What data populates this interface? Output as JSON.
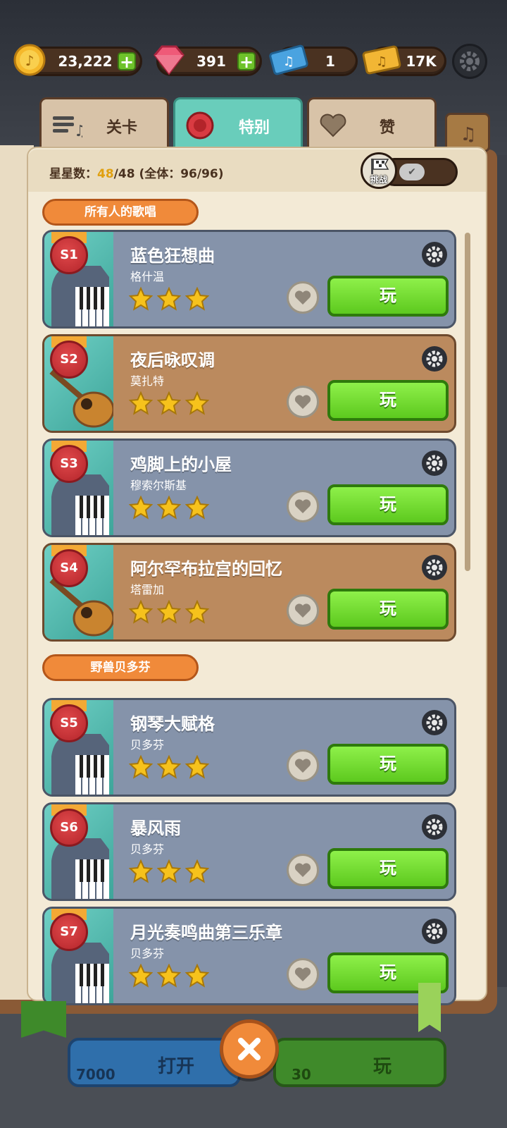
{
  "currency": {
    "coins": "23,222",
    "gems": "391",
    "tickets_blue": "1",
    "tickets_gold": "17K"
  },
  "tabs": [
    {
      "label": "关卡",
      "icon": "music-sheet-icon"
    },
    {
      "label": "特别",
      "icon": "red-seal-icon"
    },
    {
      "label": "赞",
      "icon": "heart-icon"
    }
  ],
  "stars_summary": {
    "prefix": "星星数：",
    "current": "48",
    "rest": "/48 (全体：96/96)"
  },
  "challenge": {
    "label": "挑战",
    "enabled": true
  },
  "sections": [
    {
      "title": "所有人的歌唱"
    },
    {
      "title": "野兽贝多芬"
    }
  ],
  "songs": [
    {
      "id": "S1",
      "title": "蓝色狂想曲",
      "composer": "格什温",
      "stars": 3,
      "instrument": "piano",
      "theme": "blue",
      "play": "玩"
    },
    {
      "id": "S2",
      "title": "夜后咏叹调",
      "composer": "莫扎特",
      "stars": 3,
      "instrument": "guitar",
      "theme": "brown",
      "play": "玩"
    },
    {
      "id": "S3",
      "title": "鸡脚上的小屋",
      "composer": "穆索尔斯基",
      "stars": 3,
      "instrument": "piano",
      "theme": "blue",
      "play": "玩"
    },
    {
      "id": "S4",
      "title": "阿尔罕布拉宫的回忆",
      "composer": "塔雷加",
      "stars": 3,
      "instrument": "guitar",
      "theme": "brown",
      "play": "玩"
    },
    {
      "id": "S5",
      "title": "钢琴大赋格",
      "composer": "贝多芬",
      "stars": 3,
      "instrument": "piano",
      "theme": "blue",
      "play": "玩"
    },
    {
      "id": "S6",
      "title": "暴风雨",
      "composer": "贝多芬",
      "stars": 3,
      "instrument": "piano",
      "theme": "blue",
      "play": "玩"
    },
    {
      "id": "S7",
      "title": "月光奏鸣曲第三乐章",
      "composer": "贝多芬",
      "stars": 3,
      "instrument": "piano",
      "theme": "blue",
      "play": "玩"
    }
  ],
  "bottom": {
    "open_label": "打开",
    "open_cost": "7000",
    "play_label": "玩",
    "play_cost": "30"
  },
  "colors": {
    "accent_green": "#5dc91e",
    "section_orange": "#f08a3a",
    "card_blue": "#8593aa",
    "card_brown": "#bb8a5e",
    "tab_active": "#69cdbb"
  }
}
